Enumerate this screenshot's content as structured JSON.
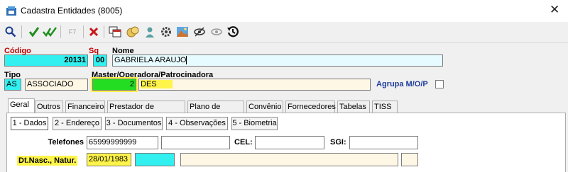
{
  "window": {
    "title": "Cadastra Entidades (8005)"
  },
  "toolbar": {
    "f7_label": "F7"
  },
  "form": {
    "codigo": {
      "label": "Código",
      "value": "20131"
    },
    "sq": {
      "label": "Sq",
      "value": "00"
    },
    "nome": {
      "label": "Nome",
      "value": "GABRIELA ARAUJO"
    },
    "tipo": {
      "label": "Tipo",
      "code": "AS",
      "description": "ASSOCIADO"
    },
    "master": {
      "label": "Master/Operadora/Patrocinadora",
      "code": "2",
      "description": "DES"
    },
    "agrupa": {
      "label": "Agrupa M/O/P"
    }
  },
  "tabs": [
    {
      "label": "Geral"
    },
    {
      "label": "Outros"
    },
    {
      "label": "Financeiro"
    },
    {
      "label": "Prestador de Serviços"
    },
    {
      "label": "Plano de Saúde"
    },
    {
      "label": "Convênio"
    },
    {
      "label": "Fornecedores"
    },
    {
      "label": "Tabelas"
    },
    {
      "label": "TISS"
    }
  ],
  "subtabs": [
    {
      "label": "1 - Dados"
    },
    {
      "label": "2 - Endereço"
    },
    {
      "label": "3 - Documentos"
    },
    {
      "label": "4 - Observações"
    },
    {
      "label": "5 - Biometria"
    }
  ],
  "dados": {
    "telefones": {
      "label": "Telefones",
      "value": "65999999999"
    },
    "cel": {
      "label": "CEL:"
    },
    "sgi": {
      "label": "SGI:"
    },
    "nascimento": {
      "label": "Dt.Nasc., Natur.",
      "value": "28/01/1983"
    }
  },
  "colors": {
    "cyan_field": "#33f0f0",
    "green_field": "#22dd22",
    "highlight": "#fff44a",
    "label_red": "#c00000",
    "label_blue": "#1f3c9c"
  }
}
